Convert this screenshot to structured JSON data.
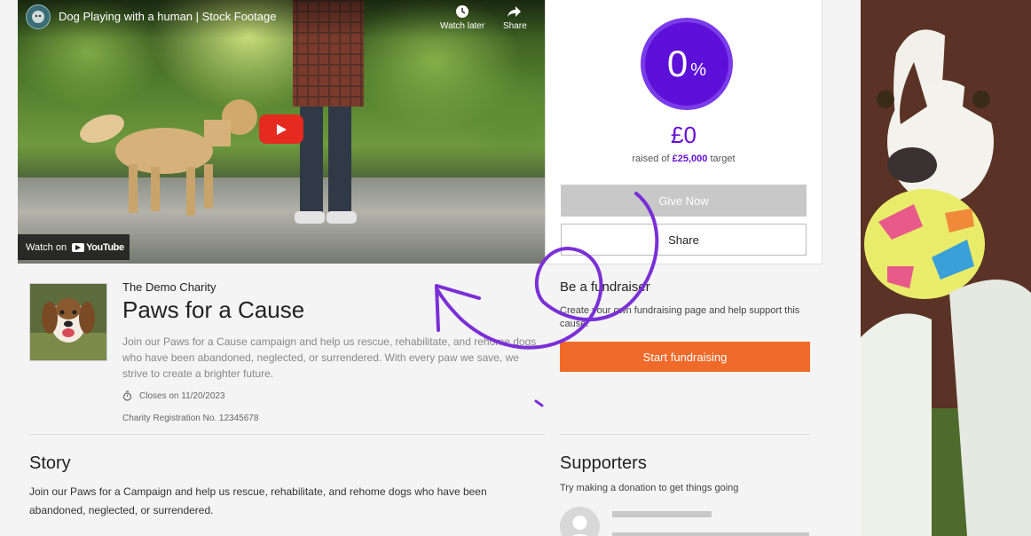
{
  "video": {
    "title": "Dog Playing with a human | Stock Footage",
    "watch_later": "Watch later",
    "share": "Share",
    "watch_on": "Watch on",
    "youtube": "YouTube"
  },
  "donate": {
    "percent": "0",
    "percent_sign": "%",
    "raised": "£0",
    "raised_prefix": "raised of",
    "target": "£25,000",
    "raised_suffix": "target",
    "give_now": "Give Now",
    "share": "Share"
  },
  "charity": {
    "name": "The Demo Charity",
    "campaign_title": "Paws for a Cause",
    "description": "Join our Paws for a Cause campaign and help us rescue, rehabilitate, and rehome dogs who have been abandoned, neglected, or surrendered. With every paw we save, we strive to create a brighter future.",
    "closes": "Closes on 11/20/2023",
    "registration": "Charity Registration No. 12345678"
  },
  "fundraiser": {
    "title": "Be a fundraiser",
    "description": "Create your own fundraising page and help support this cause.",
    "start": "Start fundraising"
  },
  "story": {
    "heading": "Story",
    "text": "Join our Paws for a Campaign and help us rescue, rehabilitate, and rehome dogs who have been abandoned, neglected, or surrendered."
  },
  "supporters": {
    "heading": "Supporters",
    "text": "Try making a donation to get things going"
  },
  "colors": {
    "accent_purple": "#6610d9",
    "ring_purple": "#5c10d8",
    "orange": "#f06a2a",
    "annotation": "#7b2fd6"
  }
}
